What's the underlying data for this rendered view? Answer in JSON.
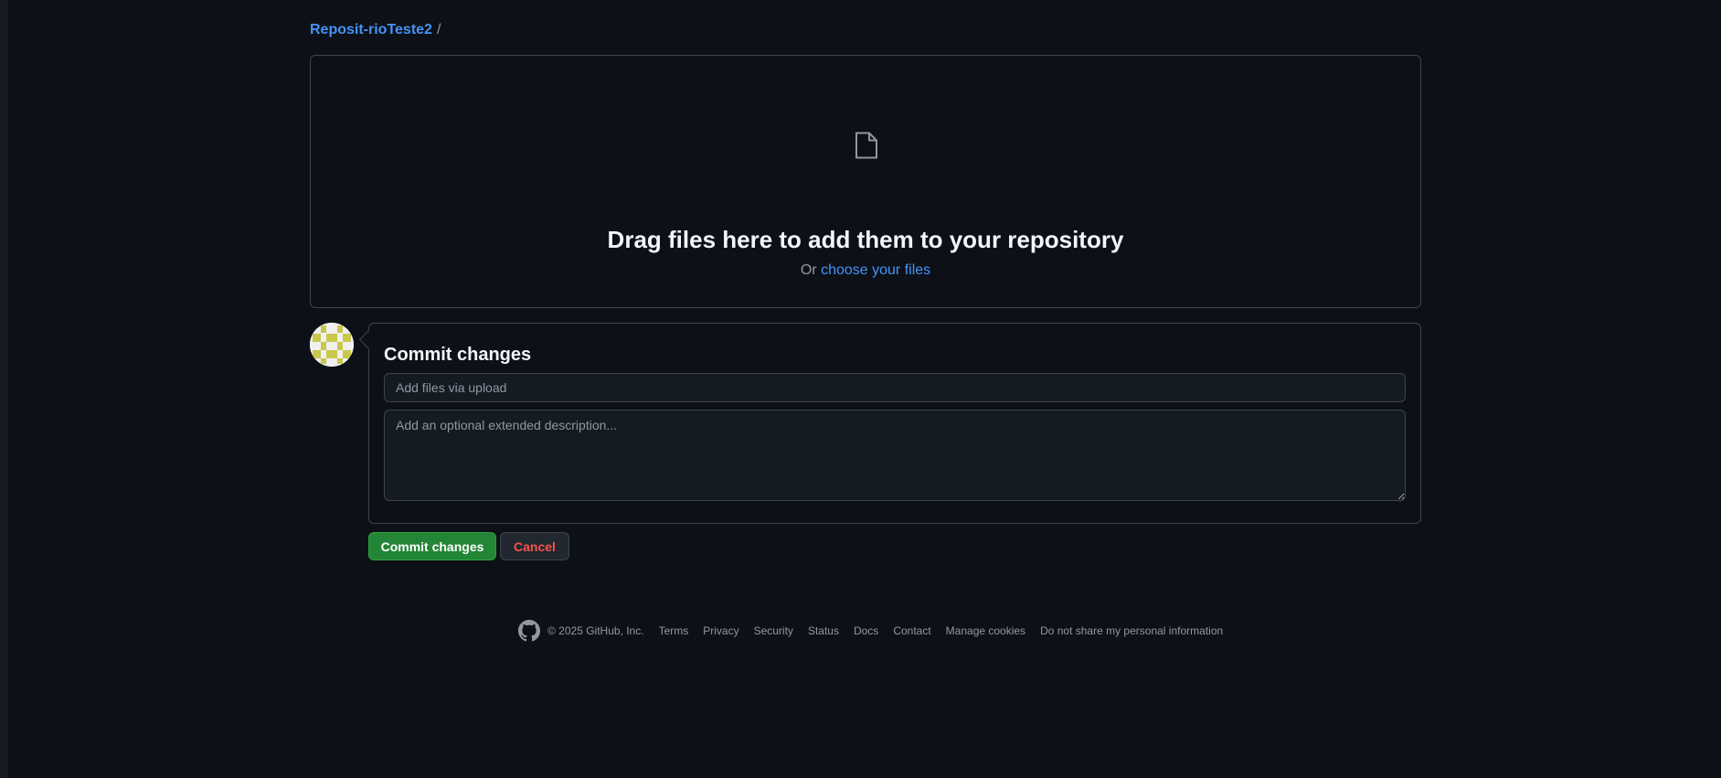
{
  "breadcrumb": {
    "repo": "Reposit-rioTeste2",
    "separator": "/"
  },
  "dropzone": {
    "icon": "file-icon",
    "title": "Drag files here to add them to your repository",
    "prefix": "Or",
    "choose_link": "choose your files"
  },
  "commit": {
    "title": "Commit changes",
    "message_placeholder": "Add files via upload",
    "description_placeholder": "Add an optional extended description..."
  },
  "buttons": {
    "commit": "Commit changes",
    "cancel": "Cancel"
  },
  "footer": {
    "copyright": "© 2025 GitHub, Inc.",
    "links": [
      "Terms",
      "Privacy",
      "Security",
      "Status",
      "Docs",
      "Contact",
      "Manage cookies",
      "Do not share my personal information"
    ]
  },
  "colors": {
    "background": "#0d1117",
    "link": "#4493f8",
    "primary_button": "#238636",
    "danger_text": "#f85149",
    "avatar": "#c8c84a"
  }
}
